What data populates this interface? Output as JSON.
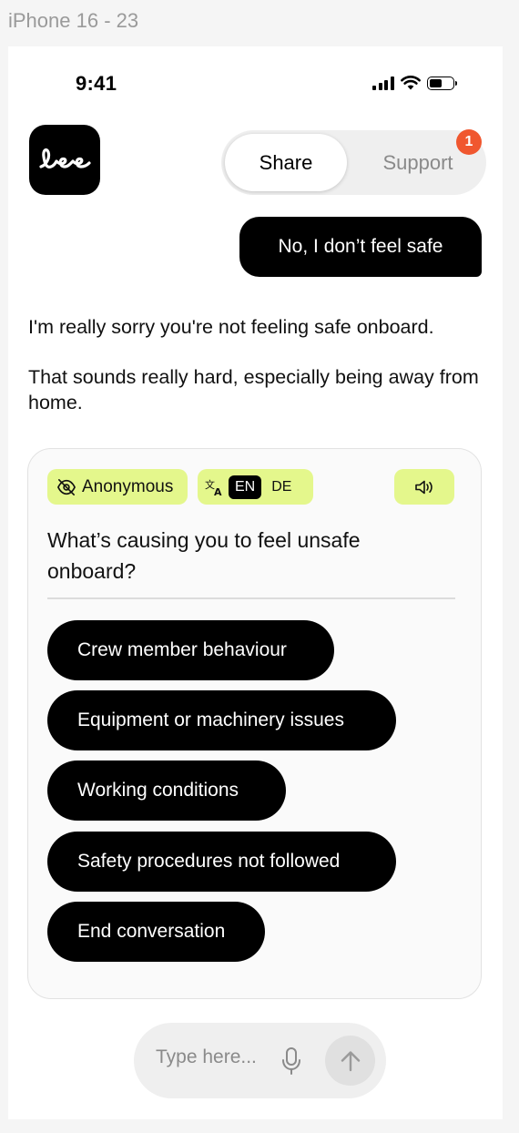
{
  "frame": {
    "label": "iPhone 16 - 23"
  },
  "status_bar": {
    "time": "9:41"
  },
  "header": {
    "logo_icon": "lee-logo",
    "tabs": [
      {
        "label": "Share",
        "selected": true
      },
      {
        "label": "Support",
        "selected": false,
        "badge": "1"
      }
    ]
  },
  "chat": {
    "user_message": "No, I don’t feel safe",
    "bot_messages": [
      "I'm really sorry you're not feeling safe onboard.",
      "That sounds really hard, especially being away from home."
    ]
  },
  "card": {
    "anonymous_label": "Anonymous",
    "languages": [
      {
        "code": "EN",
        "selected": true
      },
      {
        "code": "DE",
        "selected": false
      }
    ],
    "question": "What’s causing you to feel unsafe onboard?",
    "options": [
      "Crew member behaviour",
      "Equipment or machinery issues",
      "Working conditions",
      "Safety procedures not followed",
      "End conversation"
    ]
  },
  "input": {
    "placeholder": "Type here..."
  },
  "colors": {
    "accent_chip": "#e4f78c",
    "badge": "#f0572f",
    "bubble": "#000000"
  }
}
